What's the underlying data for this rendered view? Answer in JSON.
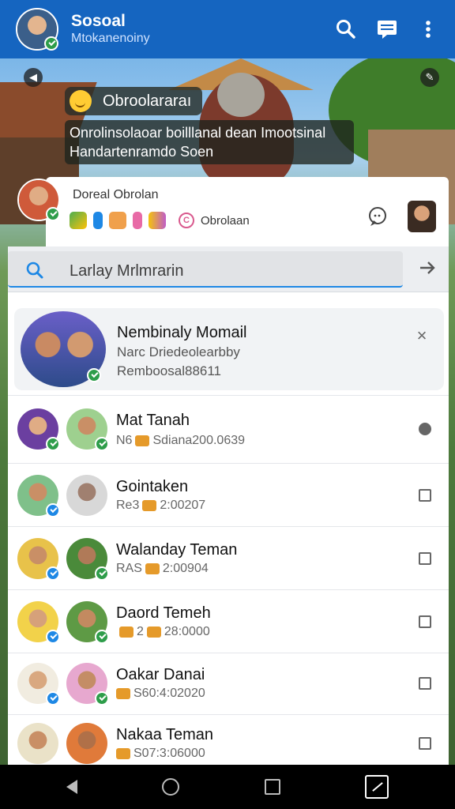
{
  "appbar": {
    "title": "Sosoal",
    "subtitle": "Mtokanenoiny"
  },
  "story": {
    "title": "Obroolararaı",
    "text_line1": "Onrolinsolaoar boilllanal dean Imootsinal",
    "text_line2": "Handartenramdo Soen"
  },
  "group": {
    "name": "Doreal Obrolan",
    "subtitle": "Obrolaan",
    "c_badge": "C"
  },
  "search": {
    "value": "Larlay Mrlmrarin"
  },
  "featured": {
    "name": "Nembinaly Momail",
    "line1": "Narc Driedeolearbby",
    "line2": "Remboosal88611",
    "close": "×"
  },
  "contacts": [
    {
      "name": "Mat Tanah",
      "prefix": "N6",
      "time": "Sdiana200.0639"
    },
    {
      "name": "Gointaken",
      "prefix": "Re3",
      "time": "2:00207"
    },
    {
      "name": "Walanday Teman",
      "prefix": "RAS",
      "time": "2:00904"
    },
    {
      "name": "Daord Temeh",
      "prefix": "2",
      "time": "28:0000"
    },
    {
      "name": "Oakar Danai",
      "prefix": "",
      "time": "S60:4:02020"
    },
    {
      "name": "Nakaa Teman",
      "prefix": "",
      "time": "S07:3:06000"
    }
  ],
  "colors": {
    "appbar": "#1565c0",
    "accent": "#1e88e5",
    "verified": "#2e9d4a"
  }
}
